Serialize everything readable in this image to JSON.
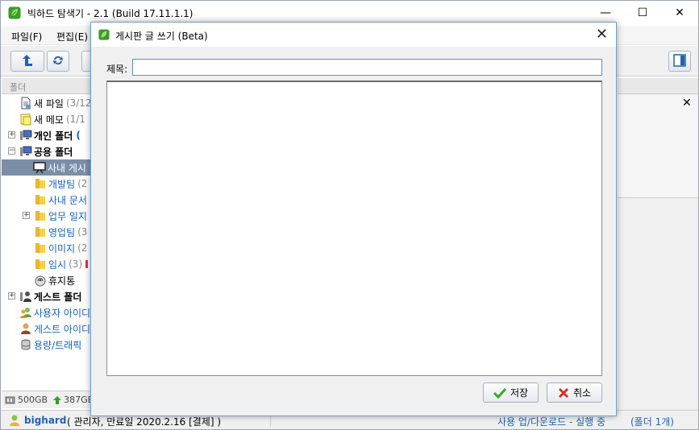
{
  "app": {
    "title": "빅하드 탐색기 - 2.1 (Build 17.11.1.1)",
    "minimize": "—",
    "maximize": "☐",
    "close": "✕"
  },
  "menu": [
    "파일(F)",
    "편집(E)"
  ],
  "folder_panel": {
    "header": "폴더",
    "nodes": [
      {
        "label": "새 파일",
        "count": "(3/12",
        "icon": "new-file-icon"
      },
      {
        "label": "새 메모",
        "count": "(1/1",
        "icon": "new-memo-icon"
      },
      {
        "label": "개인 폴더",
        "count": "(",
        "icon": "computer-folder-icon"
      },
      {
        "label": "공용 폴더",
        "count": "",
        "icon": "computer-folder-icon"
      },
      {
        "label": "사내 게시",
        "count": "",
        "icon": "board-icon"
      },
      {
        "label": "개발팀",
        "count": "(2",
        "icon": "folder-icon"
      },
      {
        "label": "사내 문서",
        "count": "",
        "icon": "folder-icon"
      },
      {
        "label": "업무 일지",
        "count": "",
        "icon": "folder-icon"
      },
      {
        "label": "영업팀",
        "count": "(3",
        "icon": "folder-icon"
      },
      {
        "label": "이미지",
        "count": "(2",
        "icon": "folder-icon"
      },
      {
        "label": "임시",
        "count": "(3)",
        "icon": "folder-icon"
      },
      {
        "label": "휴지통",
        "count": "",
        "icon": "trash-icon"
      },
      {
        "label": "게스트 폴더",
        "count": "",
        "icon": "guest-folder-icon"
      },
      {
        "label": "사용자 아이디",
        "count": "",
        "icon": "users-icon"
      },
      {
        "label": "게스트 아이디",
        "count": "",
        "icon": "guest-user-icon"
      },
      {
        "label": "용량/트래픽",
        "count": "",
        "icon": "storage-icon"
      }
    ],
    "capacity": "500GB",
    "used": "387GB"
  },
  "statusbar": {
    "user": "bighard",
    "user_info": "( 관리자, 만료일 2020.2.16 [결제] )",
    "transfer": "사용 업/다운로드 - 실행 중",
    "folder_count": "(폴더 1개)"
  },
  "dialog": {
    "title": "게시판 글 쓰기 (Beta)",
    "subject_label": "제목:",
    "subject_value": "",
    "body_value": "",
    "save_label": "저장",
    "cancel_label": "취소",
    "close": "✕"
  }
}
